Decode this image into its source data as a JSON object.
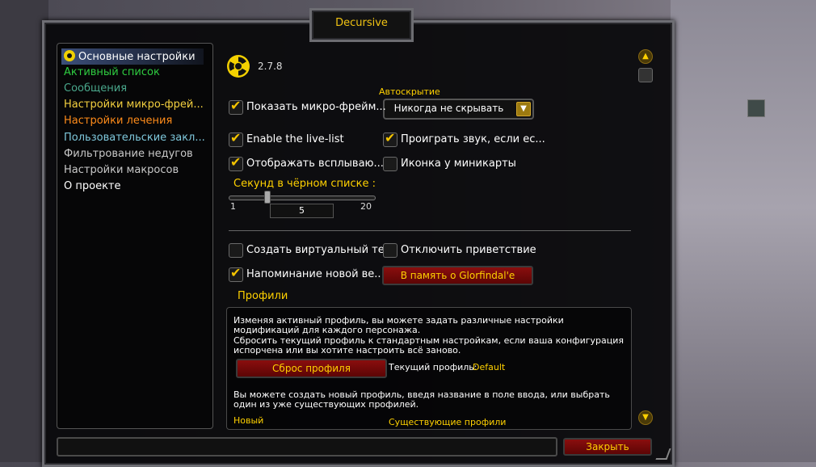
{
  "window": {
    "title": "Decursive"
  },
  "nav": {
    "items": [
      {
        "label": "Основные настройки",
        "color": "#ffffff",
        "selected": true
      },
      {
        "label": "Активный список",
        "color": "#2ecc40"
      },
      {
        "label": "Сообщения",
        "color": "#4aa88c"
      },
      {
        "label": "Настройки микро-фрей...",
        "color": "#f4d03f"
      },
      {
        "label": "Настройки лечения",
        "color": "#ff8c1a"
      },
      {
        "label": "Пользовательские закл...",
        "color": "#7fc8dc"
      },
      {
        "label": "Фильтрование недугов",
        "color": "#c8c8c8"
      },
      {
        "label": "Настройки макросов",
        "color": "#c8c8c8"
      },
      {
        "label": "О проекте",
        "color": "#ffffff"
      }
    ]
  },
  "main": {
    "version": "2.7.8",
    "autohide_label": "Автоскрытие",
    "autohide_value": "Никогда не скрывать",
    "options": {
      "show_micro": "Показать микро-фрейм...",
      "enable_livelist": "Enable the live-list",
      "play_sound": "Проиграть звук, если ес...",
      "show_popups": "Отображать всплываю...",
      "minimap_icon": "Иконка у миникарты",
      "create_virtual": "Создать виртуальный те...",
      "disable_greeting": "Отключить приветствие",
      "remind_new": "Напоминание новой ве..."
    },
    "blacklist_label": "Секунд в чёрном списке :",
    "slider_min": "1",
    "slider_max": "20",
    "slider_value": "5",
    "memory_button": "В память о Glorfindal'e",
    "profiles": {
      "header": "Профили",
      "text1": "Изменяя активный профиль, вы можете задать различные настройки модификаций для каждого персонажа.",
      "text2": "Сбросить текущий профиль к стандартным настройкам, если ваша конфигурация испорчена или вы хотите настроить всё заново.",
      "reset_button": "Сброс профиля",
      "current_label": "Текущий профиль:",
      "current_value": "Default",
      "text3": "Вы можете создать новый профиль, введя название в поле ввода, или выбрать один из уже существующих профилей.",
      "new_label": "Новый",
      "existing_label": "Существующие профили"
    }
  },
  "footer": {
    "close_button": "Закрыть"
  },
  "colors": {
    "gold": "#ffd100",
    "accent_red": "#7a0a0a"
  }
}
